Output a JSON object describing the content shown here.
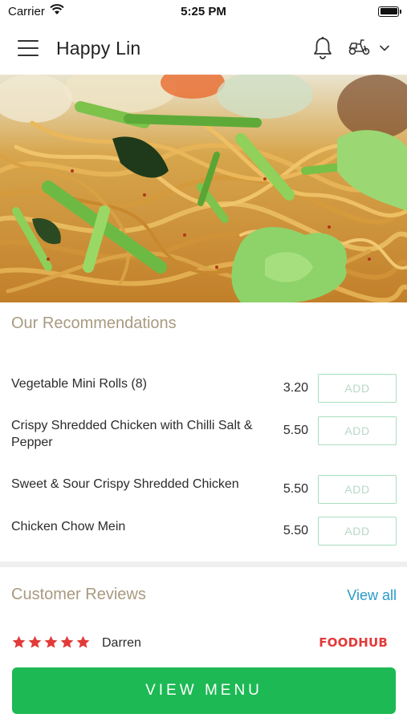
{
  "status_bar": {
    "carrier": "Carrier",
    "time": "5:25 PM"
  },
  "header": {
    "title": "Happy Lin"
  },
  "recommendations": {
    "title": "Our Recommendations",
    "add_label": "ADD",
    "items": [
      {
        "name": "Vegetable Mini Rolls (8)",
        "price": "3.20"
      },
      {
        "name": "Crispy Shredded Chicken with Chilli Salt & Pepper",
        "price": "5.50"
      },
      {
        "name": "Sweet & Sour Crispy Shredded Chicken",
        "price": "5.50"
      },
      {
        "name": "Chicken Chow Mein",
        "price": "5.50"
      }
    ]
  },
  "reviews": {
    "title": "Customer Reviews",
    "view_all_label": "View all",
    "items": [
      {
        "reviewer": "Darren",
        "rating": 5,
        "source": "FOODHUB"
      }
    ]
  },
  "cta": {
    "label": "VIEW MENU"
  },
  "colors": {
    "accent_green": "#1db954",
    "add_border": "#a8dfc0",
    "link_blue": "#2a9bc9",
    "star_red": "#e23a3a",
    "section_title": "#a89a80"
  },
  "icons": [
    "wifi-icon",
    "battery-icon",
    "menu-icon",
    "bell-icon",
    "scooter-icon",
    "chevron-down-icon",
    "star-icon"
  ]
}
